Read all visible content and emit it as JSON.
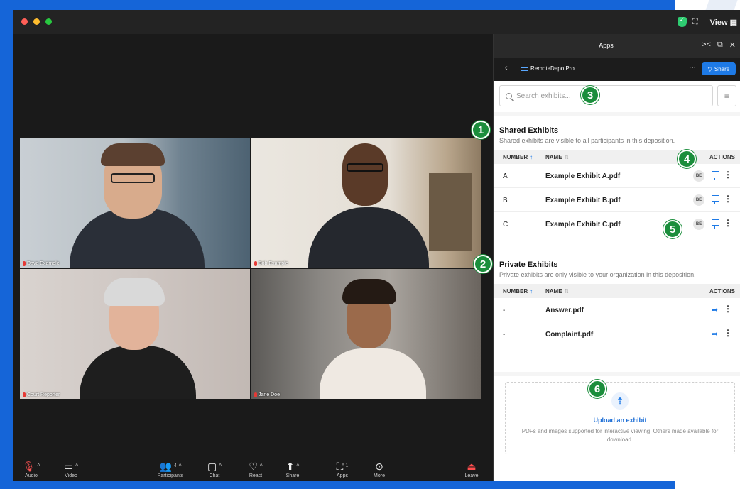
{
  "titlebar": {
    "view_label": "View"
  },
  "participants": [
    {
      "name": "Dave Example"
    },
    {
      "name": "Bob Example"
    },
    {
      "name": "Court Reporter"
    },
    {
      "name": "Jane Doe"
    }
  ],
  "toolbar": {
    "audio": "Audio",
    "video": "Video",
    "participants": "Participants",
    "participants_count": "4",
    "chat": "Chat",
    "react": "React",
    "share": "Share",
    "apps": "Apps",
    "apps_count": "1",
    "more": "More",
    "leave": "Leave"
  },
  "panel": {
    "title": "Apps",
    "app_name": "RemoteDepo Pro",
    "share_label": "Share",
    "search_placeholder": "Search exhibits...",
    "shared": {
      "title": "Shared Exhibits",
      "description": "Shared exhibits are visible to all participants in this deposition.",
      "col_number": "NUMBER",
      "col_name": "NAME",
      "col_actions": "ACTIONS",
      "rows": [
        {
          "number": "A",
          "name": "Example Exhibit A.pdf",
          "badge": "BE"
        },
        {
          "number": "B",
          "name": "Example Exhibit B.pdf",
          "badge": "BE"
        },
        {
          "number": "C",
          "name": "Example Exhibit C.pdf",
          "badge": "BE"
        }
      ]
    },
    "private": {
      "title": "Private Exhibits",
      "description": "Private exhibits are only visible to your organization in this deposition.",
      "col_number": "NUMBER",
      "col_name": "NAME",
      "col_actions": "ACTIONS",
      "rows": [
        {
          "number": "-",
          "name": "Answer.pdf"
        },
        {
          "number": "-",
          "name": "Complaint.pdf"
        }
      ]
    },
    "upload": {
      "title": "Upload an exhibit",
      "description": "PDFs and images supported for interactive viewing. Others made available for download."
    }
  },
  "callouts": [
    "1",
    "2",
    "3",
    "4",
    "5",
    "6"
  ],
  "colors": {
    "accent": "#1e7ae6",
    "callout": "#1b8e3c",
    "mic_off": "#e53935"
  }
}
